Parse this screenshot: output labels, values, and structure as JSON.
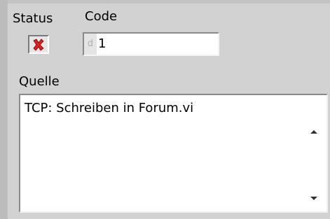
{
  "labels": {
    "status": "Status",
    "code": "Code",
    "quelle": "Quelle"
  },
  "status": {
    "value": false,
    "icon": "red-x-icon",
    "color": "#e02020"
  },
  "code": {
    "radix": "d",
    "value": "1"
  },
  "quelle": {
    "text": "TCP: Schreiben in Forum.vi"
  }
}
